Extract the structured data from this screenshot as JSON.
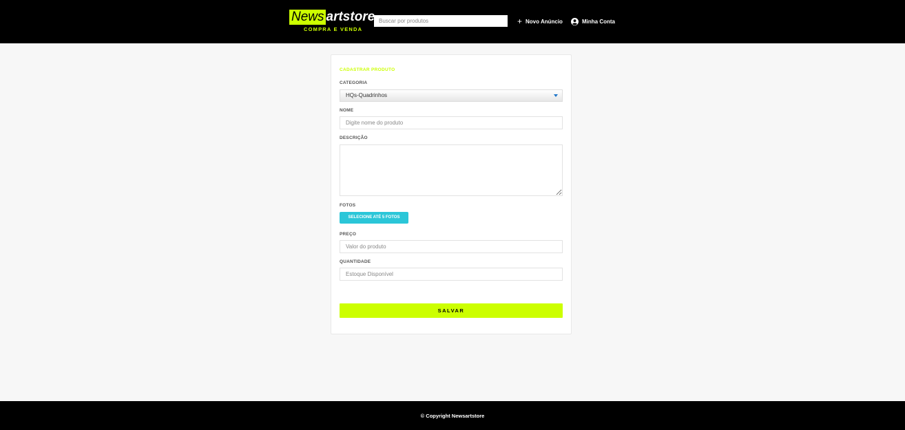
{
  "header": {
    "logo_news": "News",
    "logo_rest": "artstore",
    "logo_tagline": "COMPRA E VENDA",
    "search_placeholder": "Buscar por produtos",
    "new_ad_label": "Novo Anúncio",
    "account_label": "Minha Conta",
    "icons": {
      "new_ad": "plus-icon",
      "account": "user-circle-icon"
    }
  },
  "form": {
    "title": "CADASTRAR PRODUTO",
    "category_label": "CATEGORIA",
    "category_value": "HQs-Quadrinhos",
    "name_label": "NOME",
    "name_placeholder": "Digite nome do produto",
    "description_label": "DESCRIÇÃO",
    "photos_label": "FOTOS",
    "photos_button": "SELECIONE ATÉ 5 FOTOS",
    "price_label": "PREÇO",
    "price_placeholder": "Valor do produto",
    "quantity_label": "QUANTIDADE",
    "quantity_placeholder": "Estoque Disponível",
    "save_button": "SALVAR"
  },
  "footer": {
    "copyright": "© Copyright Newsartstore"
  },
  "colors": {
    "accent": "#ccff00",
    "photo_button": "#2bc6d8",
    "header_bg": "#000000",
    "page_bg": "#f7f7f7"
  }
}
